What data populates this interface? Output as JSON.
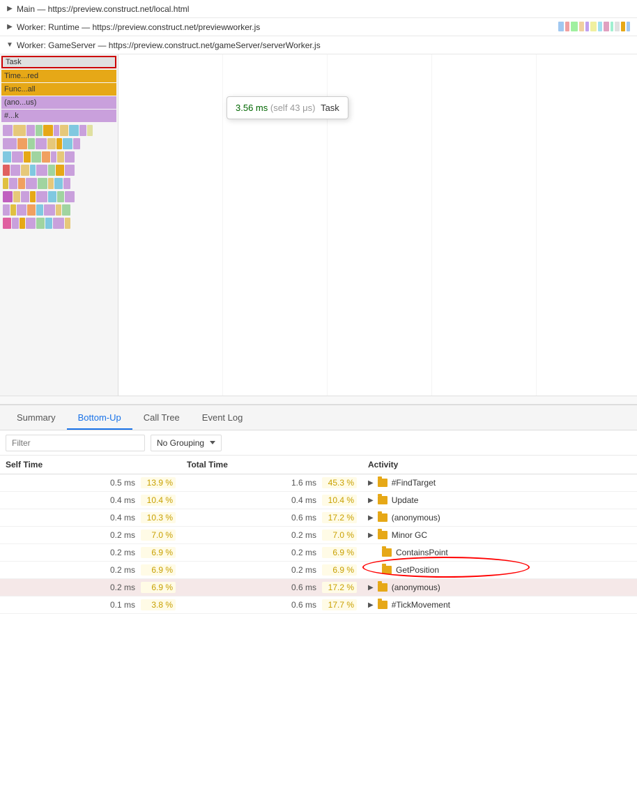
{
  "threads": [
    {
      "id": "main",
      "label": "Main — https://preview.construct.net/local.html",
      "collapsed": true,
      "arrow": "▶"
    },
    {
      "id": "runtime",
      "label": "Worker: Runtime — https://preview.construct.net/previewworker.js",
      "collapsed": true,
      "arrow": "▶"
    },
    {
      "id": "gameserver",
      "label": "Worker: GameServer — https://preview.construct.net/gameServer/serverWorker.js",
      "collapsed": false,
      "arrow": "▼"
    }
  ],
  "flame_labels": [
    {
      "id": "task",
      "text": "Task",
      "type": "task"
    },
    {
      "id": "time",
      "text": "Time...red",
      "type": "time"
    },
    {
      "id": "func",
      "text": "Func...all",
      "type": "func"
    },
    {
      "id": "anon",
      "text": "(ano...us)",
      "type": "anon"
    },
    {
      "id": "hash",
      "text": "#...k",
      "type": "hash"
    }
  ],
  "tooltip": {
    "time": "3.56 ms",
    "self": "(self 43 μs)",
    "name": "Task"
  },
  "tabs": [
    {
      "id": "summary",
      "label": "Summary",
      "active": false
    },
    {
      "id": "bottom-up",
      "label": "Bottom-Up",
      "active": true
    },
    {
      "id": "call-tree",
      "label": "Call Tree",
      "active": false
    },
    {
      "id": "event-log",
      "label": "Event Log",
      "active": false
    }
  ],
  "filter": {
    "placeholder": "Filter",
    "grouping_label": "No Grouping"
  },
  "table": {
    "headers": [
      {
        "id": "self-time",
        "label": "Self Time"
      },
      {
        "id": "total-time",
        "label": "Total Time"
      },
      {
        "id": "activity",
        "label": "Activity"
      }
    ],
    "rows": [
      {
        "self_ms": "0.5 ms",
        "self_pct": "13.9 %",
        "total_ms": "1.6 ms",
        "total_pct": "45.3 %",
        "has_expand": true,
        "activity": "#FindTarget",
        "highlighted": false
      },
      {
        "self_ms": "0.4 ms",
        "self_pct": "10.4 %",
        "total_ms": "0.4 ms",
        "total_pct": "10.4 %",
        "has_expand": true,
        "activity": "Update",
        "highlighted": false
      },
      {
        "self_ms": "0.4 ms",
        "self_pct": "10.3 %",
        "total_ms": "0.6 ms",
        "total_pct": "17.2 %",
        "has_expand": true,
        "activity": "(anonymous)",
        "highlighted": false
      },
      {
        "self_ms": "0.2 ms",
        "self_pct": "7.0 %",
        "total_ms": "0.2 ms",
        "total_pct": "7.0 %",
        "has_expand": true,
        "activity": "Minor GC",
        "highlighted": false
      },
      {
        "self_ms": "0.2 ms",
        "self_pct": "6.9 %",
        "total_ms": "0.2 ms",
        "total_pct": "6.9 %",
        "has_expand": false,
        "activity": "ContainsPoint",
        "highlighted": false
      },
      {
        "self_ms": "0.2 ms",
        "self_pct": "6.9 %",
        "total_ms": "0.2 ms",
        "total_pct": "6.9 %",
        "has_expand": false,
        "activity": "GetPosition",
        "highlighted": false
      },
      {
        "self_ms": "0.2 ms",
        "self_pct": "6.9 %",
        "total_ms": "0.6 ms",
        "total_pct": "17.2 %",
        "has_expand": true,
        "activity": "(anonymous)",
        "highlighted": true
      },
      {
        "self_ms": "0.1 ms",
        "self_pct": "3.8 %",
        "total_ms": "0.6 ms",
        "total_pct": "17.7 %",
        "has_expand": true,
        "activity": "#TickMovement",
        "highlighted": false
      }
    ]
  }
}
